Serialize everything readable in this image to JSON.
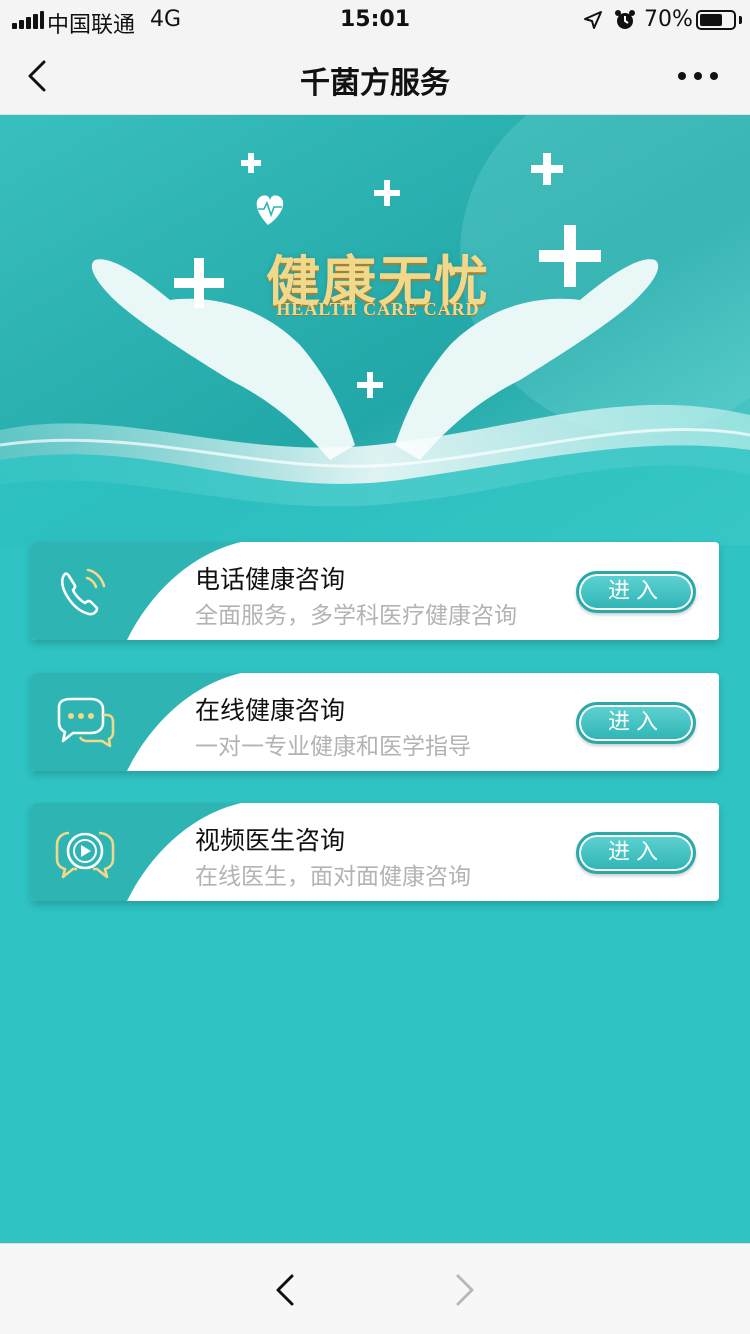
{
  "status_bar": {
    "carrier": "中国联通",
    "network": "4G",
    "time": "15:01",
    "battery_percent": "70%",
    "battery_level": 0.7
  },
  "nav": {
    "title": "千菌方服务",
    "back_icon": "chevron-left-icon",
    "more_icon": "more-dots-icon"
  },
  "hero": {
    "title": "健康无忧",
    "subtitle": "HEALTH CARE CARD"
  },
  "services": [
    {
      "title": "电话健康咨询",
      "subtitle": "全面服务，多学科医疗健康咨询",
      "button": "进入",
      "icon": "phone-call-icon"
    },
    {
      "title": "在线健康咨询",
      "subtitle": "一对一专业健康和医学指导",
      "button": "进入",
      "icon": "chat-bubble-icon"
    },
    {
      "title": "视频医生咨询",
      "subtitle": "在线医生，面对面健康咨询",
      "button": "进入",
      "icon": "video-play-icon"
    }
  ],
  "colors": {
    "background": "#2fc3c3",
    "accent": "#2fb4b4",
    "gold": "#f1d88a"
  }
}
